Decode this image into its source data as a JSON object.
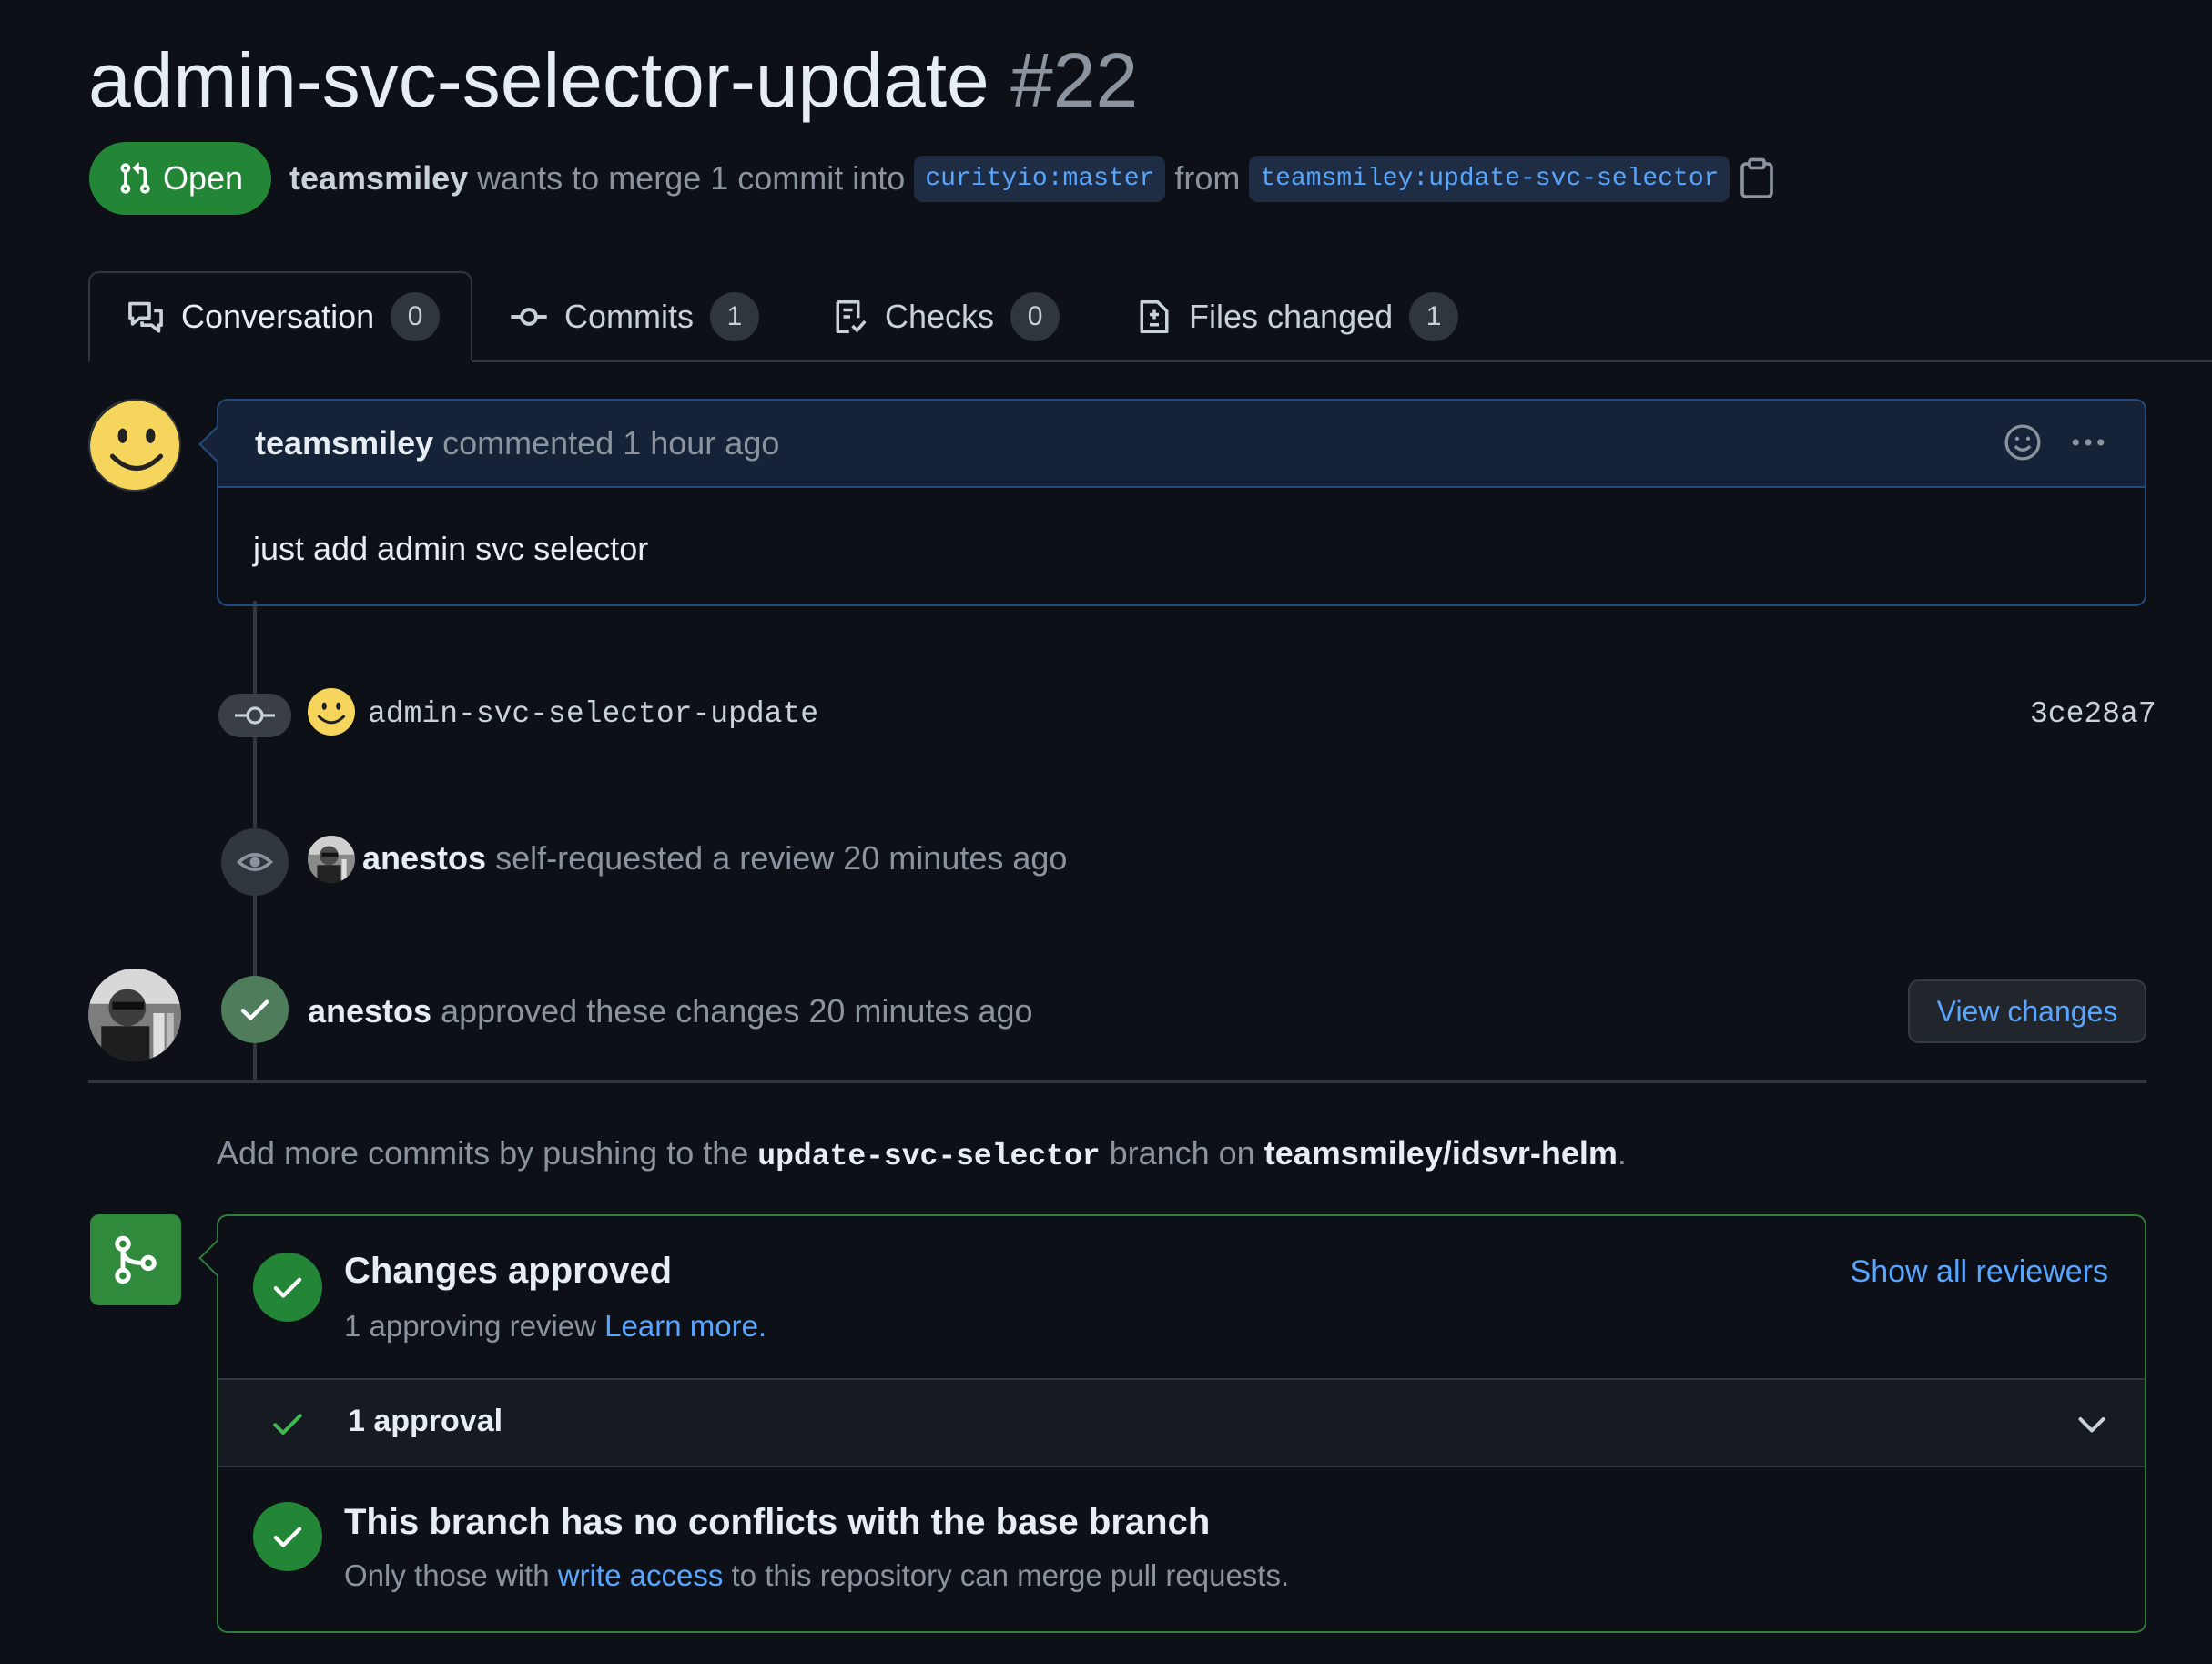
{
  "pr": {
    "title": "admin-svc-selector-update",
    "number": "#22",
    "state": "Open",
    "author": "teamsmiley",
    "merge_text_1": "wants to merge 1 commit into",
    "base_branch": "curityio:master",
    "from_text": "from",
    "head_branch": "teamsmiley:update-svc-selector"
  },
  "tabs": [
    {
      "label": "Conversation",
      "count": "0",
      "icon": "comment-discussion-icon"
    },
    {
      "label": "Commits",
      "count": "1",
      "icon": "git-commit-icon"
    },
    {
      "label": "Checks",
      "count": "0",
      "icon": "checklist-icon"
    },
    {
      "label": "Files changed",
      "count": "1",
      "icon": "file-diff-icon"
    }
  ],
  "comment": {
    "author": "teamsmiley",
    "meta": "commented 1 hour ago",
    "body": "just add admin svc selector"
  },
  "commit": {
    "message": "admin-svc-selector-update",
    "sha": "3ce28a7"
  },
  "review_request": {
    "author": "anestos",
    "text": "self-requested a review 20 minutes ago"
  },
  "approval_event": {
    "author": "anestos",
    "text": "approved these changes 20 minutes ago",
    "button": "View changes"
  },
  "push_hint": {
    "prefix": "Add more commits by pushing to the",
    "branch": "update-svc-selector",
    "middle": "branch on",
    "repo": "teamsmiley/idsvr-helm",
    "suffix": "."
  },
  "merge_box": {
    "approved_title": "Changes approved",
    "approved_sub": "1 approving review",
    "learn_more": "Learn more.",
    "show_all_reviewers": "Show all reviewers",
    "approval_count": "1 approval",
    "conflicts_title": "This branch has no conflicts with the base branch",
    "conflicts_sub_1": "Only those with",
    "write_access": "write access",
    "conflicts_sub_2": "to this repository can merge pull requests."
  },
  "colors": {
    "background": "#0d1117",
    "open_green": "#238636",
    "link_blue": "#58a6ff",
    "comment_header": "#162238"
  }
}
